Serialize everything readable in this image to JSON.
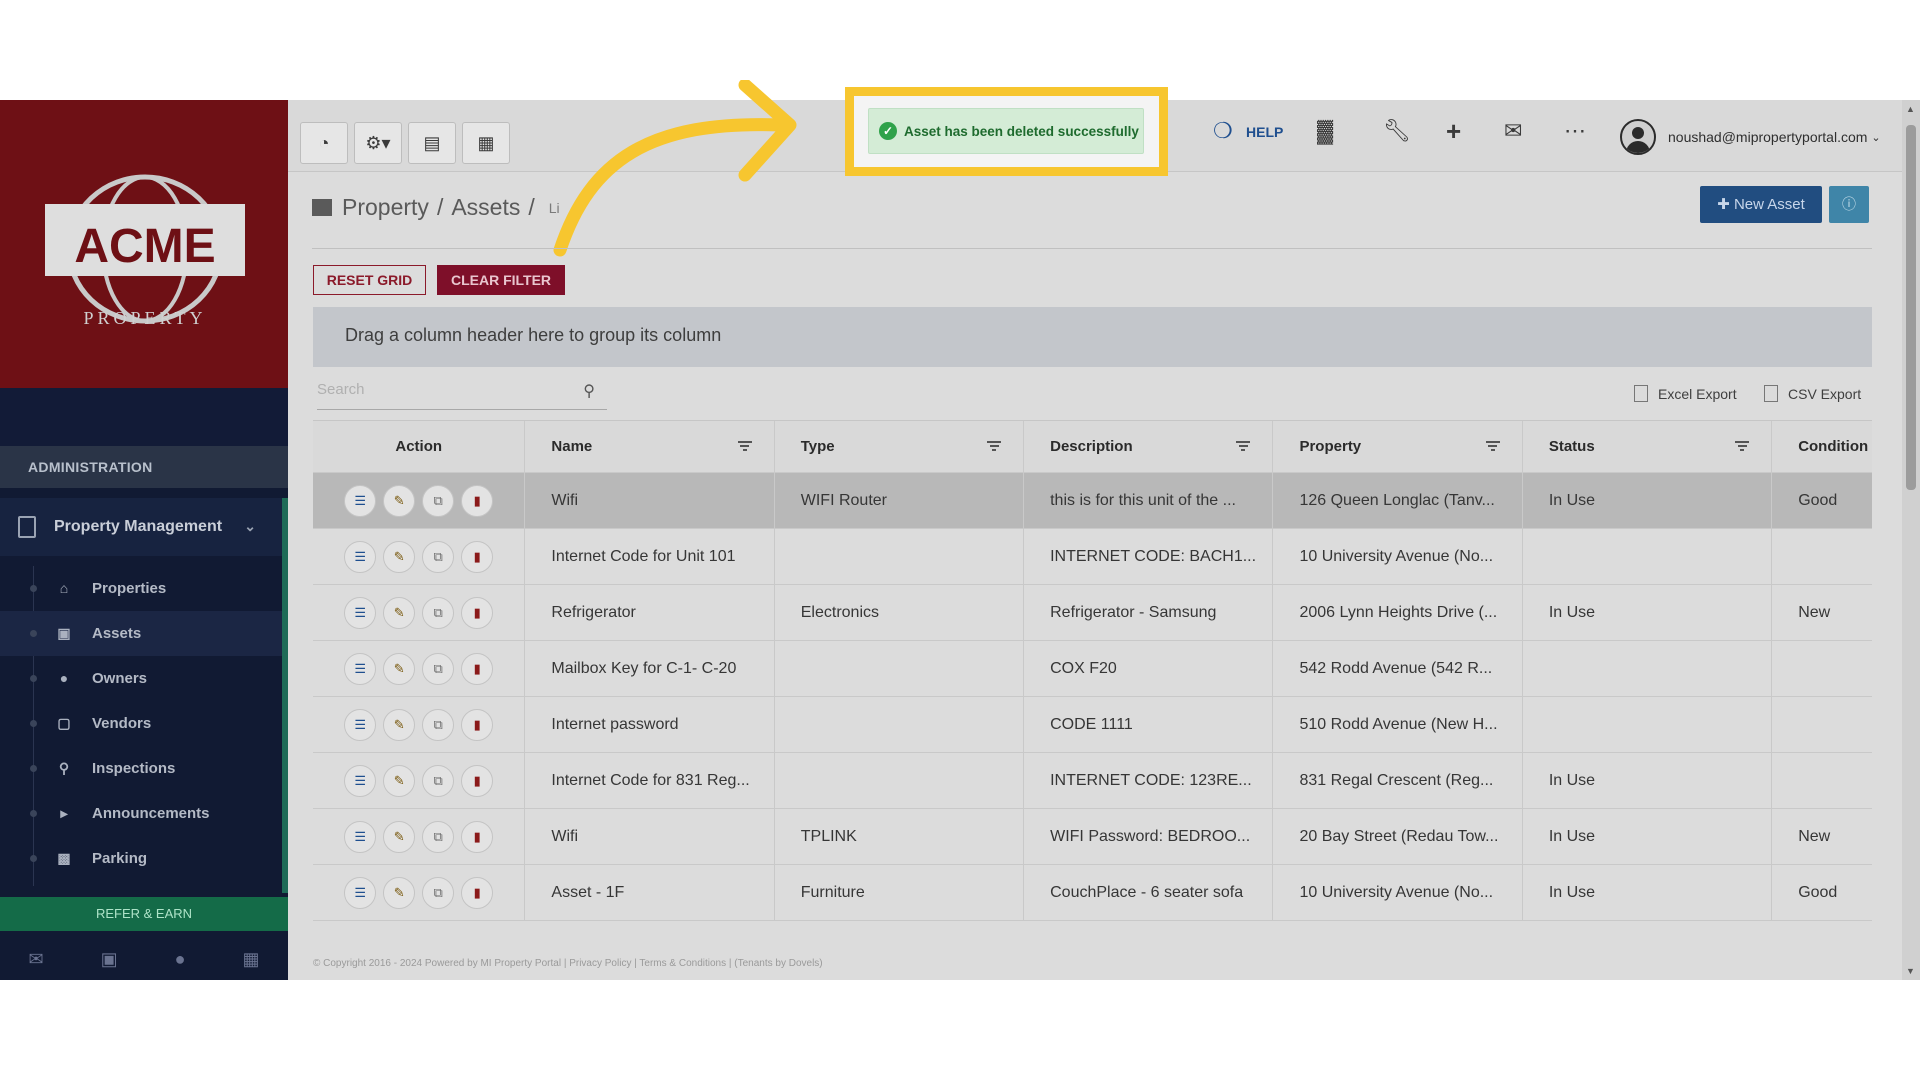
{
  "brand": {
    "logo_text": "ACME",
    "logo_sub": "PROPERTY"
  },
  "sidebar": {
    "section": "ADMINISTRATION",
    "group": "Property Management",
    "items": [
      {
        "label": "Properties",
        "icon": "home-icon"
      },
      {
        "label": "Assets",
        "icon": "archive-icon",
        "active": true
      },
      {
        "label": "Owners",
        "icon": "user-icon"
      },
      {
        "label": "Vendors",
        "icon": "briefcase-icon"
      },
      {
        "label": "Inspections",
        "icon": "search-icon"
      },
      {
        "label": "Announcements",
        "icon": "megaphone-icon"
      },
      {
        "label": "Parking",
        "icon": "car-icon"
      }
    ],
    "refer": "REFER & EARN"
  },
  "topbar": {
    "toast": "Asset has been deleted successfully",
    "help": "HELP",
    "user_email": "noushad@mipropertyportal.com"
  },
  "breadcrumb": {
    "part1": "Property",
    "part2": "Assets",
    "part3": "Li"
  },
  "buttons": {
    "new_asset": "New Asset",
    "reset_grid": "RESET GRID",
    "clear_filter": "CLEAR FILTER"
  },
  "grid": {
    "group_hint": "Drag a column header here to group its column",
    "search_placeholder": "Search",
    "excel": "Excel Export",
    "csv": "CSV Export",
    "columns": [
      "Action",
      "Name",
      "Type",
      "Description",
      "Property",
      "Status",
      "Condition"
    ],
    "rows": [
      {
        "name": "Wifi",
        "type": "WIFI Router",
        "desc": "this is for this unit of the ...",
        "prop": "126 Queen Longlac (Tanv...",
        "status": "In Use",
        "cond": "Good"
      },
      {
        "name": "Internet Code for Unit 101",
        "type": "",
        "desc": "INTERNET CODE: BACH1...",
        "prop": "10 University Avenue (No...",
        "status": "",
        "cond": ""
      },
      {
        "name": "Refrigerator",
        "type": "Electronics",
        "desc": "Refrigerator - Samsung",
        "prop": "2006 Lynn Heights Drive (...",
        "status": "In Use",
        "cond": "New"
      },
      {
        "name": "Mailbox Key for C-1- C-20",
        "type": "",
        "desc": "COX F20",
        "prop": "542 Rodd Avenue (542 R...",
        "status": "",
        "cond": ""
      },
      {
        "name": "Internet password",
        "type": "",
        "desc": "CODE 1111",
        "prop": "510 Rodd Avenue (New H...",
        "status": "",
        "cond": ""
      },
      {
        "name": "Internet Code for 831 Reg...",
        "type": "",
        "desc": "INTERNET CODE: 123RE...",
        "prop": "831 Regal Crescent (Reg...",
        "status": "In Use",
        "cond": ""
      },
      {
        "name": "Wifi",
        "type": "TPLINK",
        "desc": "WIFI Password: BEDROO...",
        "prop": "20 Bay Street (Redau Tow...",
        "status": "In Use",
        "cond": "New"
      },
      {
        "name": "Asset - 1F",
        "type": "Furniture",
        "desc": "CouchPlace - 6 seater sofa",
        "prop": "10 University Avenue (No...",
        "status": "In Use",
        "cond": "Good"
      }
    ]
  },
  "footer": "© Copyright 2016 - 2024 Powered by MI Property Portal | Privacy Policy | Terms & Conditions | (Tenants by Dovels)",
  "colors": {
    "highlight": "#f7c62f",
    "brand_red": "#6e1015",
    "primary": "#214d80"
  }
}
